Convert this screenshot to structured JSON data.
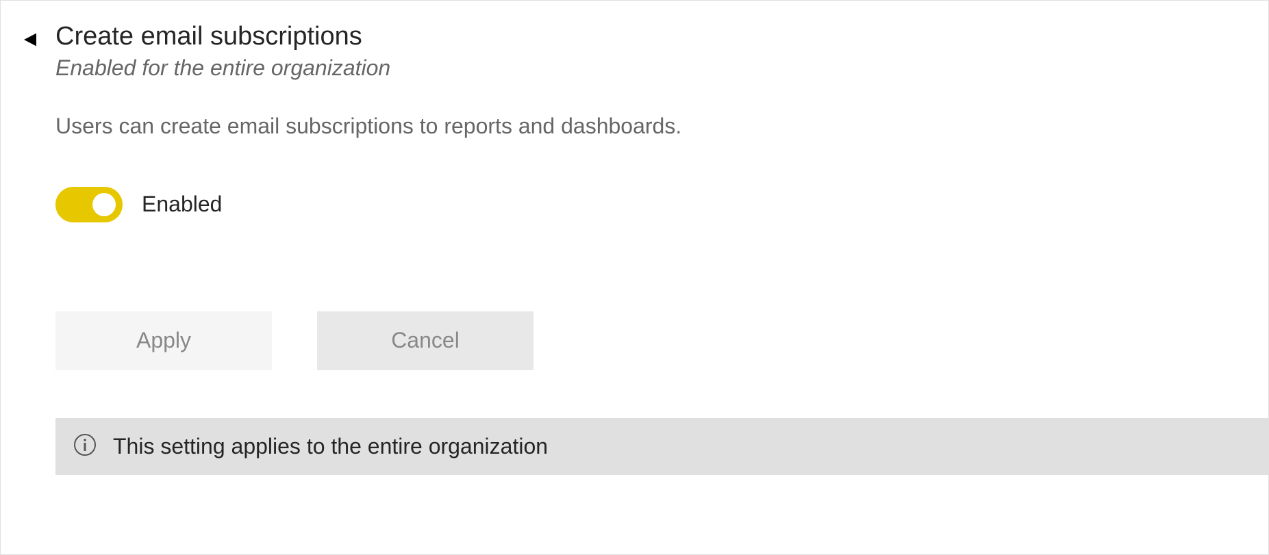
{
  "setting": {
    "title": "Create email subscriptions",
    "subtitle": "Enabled for the entire organization",
    "description": "Users can create email subscriptions to reports and dashboards.",
    "toggle_label": "Enabled"
  },
  "buttons": {
    "apply": "Apply",
    "cancel": "Cancel"
  },
  "info": {
    "message": "This setting applies to the entire organization"
  }
}
